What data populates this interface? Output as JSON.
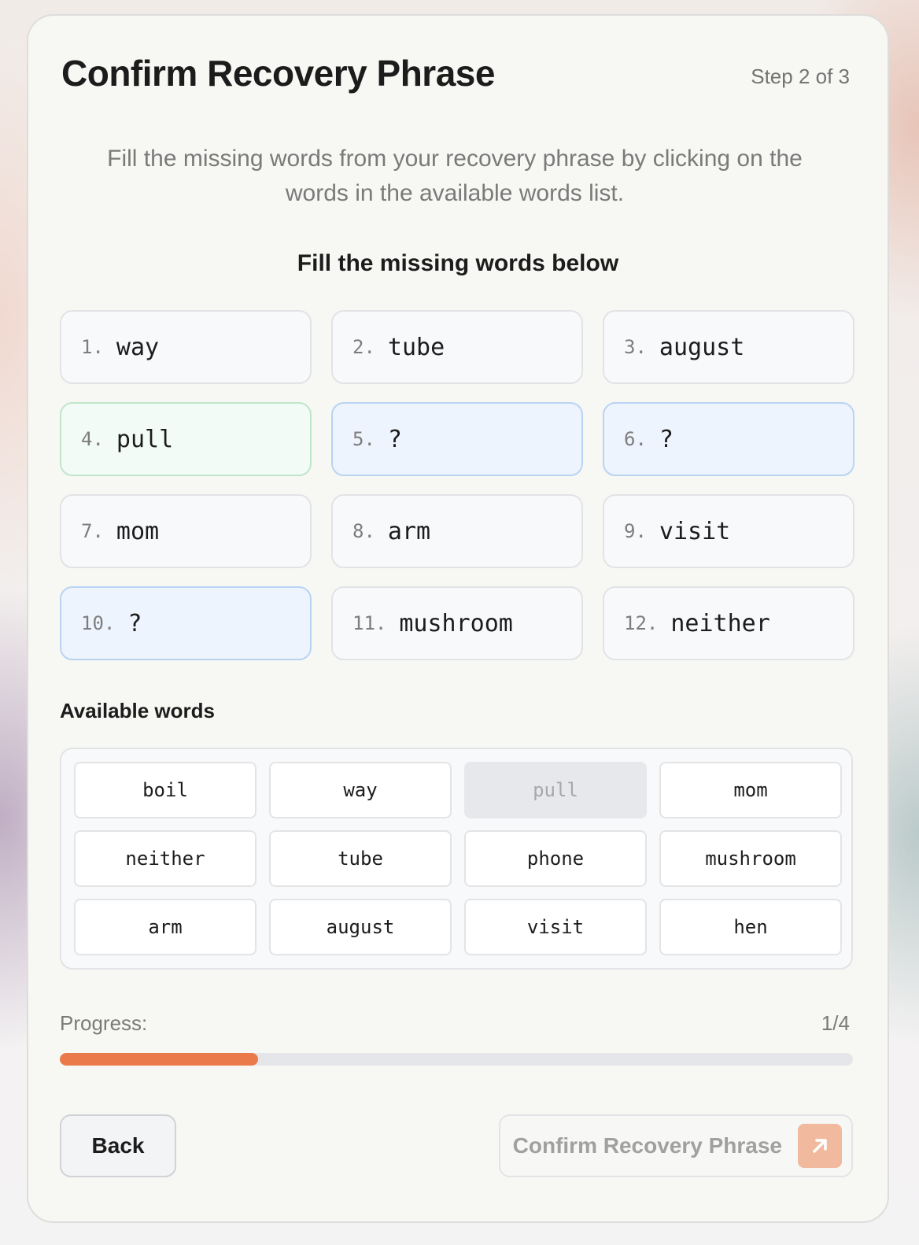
{
  "header": {
    "title": "Confirm Recovery Phrase",
    "step": "Step 2 of 3"
  },
  "instructions": "Fill the missing words from your recovery phrase by clicking on the words in the available words list.",
  "slots_title": "Fill the missing words below",
  "slots": [
    {
      "num": "1.",
      "word": "way",
      "state": "filled"
    },
    {
      "num": "2.",
      "word": "tube",
      "state": "filled"
    },
    {
      "num": "3.",
      "word": "august",
      "state": "filled"
    },
    {
      "num": "4.",
      "word": "pull",
      "state": "correct"
    },
    {
      "num": "5.",
      "word": "?",
      "state": "empty"
    },
    {
      "num": "6.",
      "word": "?",
      "state": "empty"
    },
    {
      "num": "7.",
      "word": "mom",
      "state": "filled"
    },
    {
      "num": "8.",
      "word": "arm",
      "state": "filled"
    },
    {
      "num": "9.",
      "word": "visit",
      "state": "filled"
    },
    {
      "num": "10.",
      "word": "?",
      "state": "empty"
    },
    {
      "num": "11.",
      "word": "mushroom",
      "state": "filled"
    },
    {
      "num": "12.",
      "word": "neither",
      "state": "filled"
    }
  ],
  "available_title": "Available words",
  "available_words": [
    {
      "word": "boil",
      "used": false
    },
    {
      "word": "way",
      "used": false
    },
    {
      "word": "pull",
      "used": true
    },
    {
      "word": "mom",
      "used": false
    },
    {
      "word": "neither",
      "used": false
    },
    {
      "word": "tube",
      "used": false
    },
    {
      "word": "phone",
      "used": false
    },
    {
      "word": "mushroom",
      "used": false
    },
    {
      "word": "arm",
      "used": false
    },
    {
      "word": "august",
      "used": false
    },
    {
      "word": "visit",
      "used": false
    },
    {
      "word": "hen",
      "used": false
    }
  ],
  "progress": {
    "label": "Progress:",
    "text": "1/4",
    "fraction": 0.25
  },
  "buttons": {
    "back": "Back",
    "confirm": "Confirm Recovery Phrase"
  },
  "icons": {
    "confirm": "arrow-up-right-icon"
  },
  "colors": {
    "accent": "#ea7a4a",
    "accent_muted": "#f1b99d",
    "empty_slot": "#eef4fd",
    "correct_slot": "#f3fbf6"
  }
}
